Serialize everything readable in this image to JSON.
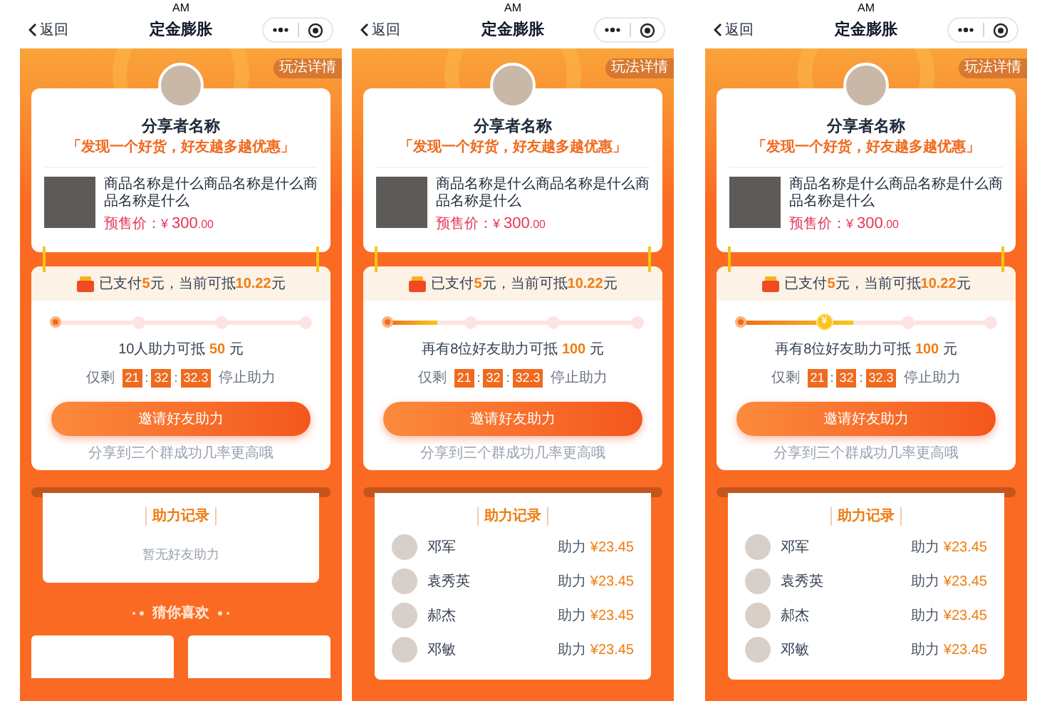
{
  "screens": [
    {
      "status_time": "AM",
      "back_label": "返回",
      "title": "定金膨胀",
      "rules_label": "玩法详情",
      "sharer_name": "分享者名称",
      "slogan": "「发现一个好货，好友越多越优惠」",
      "product": {
        "name": "商品名称是什么商品名称是什么商品名称是什么",
        "price_label": "预售价：",
        "currency": "¥",
        "price": "300",
        "price_decimals": ".00"
      },
      "paid": [
        {
          "text": "已支付",
          "em": false
        },
        {
          "text": "5",
          "em": true
        },
        {
          "text": "元，当前可抵",
          "em": false
        },
        {
          "text": "10.22",
          "em": true
        },
        {
          "text": "元",
          "em": false
        }
      ],
      "progress": {
        "level": 0,
        "nodes": [
          {
            "kind": "current"
          },
          {
            "kind": "pending"
          },
          {
            "kind": "pending"
          },
          {
            "kind": "pending"
          }
        ]
      },
      "goal": {
        "before": "10人助力可抵",
        "amount": "50",
        "after": "元"
      },
      "countdown": {
        "prefix": "仅剩",
        "parts": [
          "21",
          "32",
          "32.3"
        ],
        "separator": ":",
        "suffix": "停止助力"
      },
      "invite_button": "邀请好友助力",
      "hint": "分享到三个群成功几率更高哦",
      "records": {
        "title": "助力记录",
        "empty_text": "暂无好友助力"
      },
      "recommend_title": "猜你喜欢"
    },
    {
      "status_time": "AM",
      "back_label": "返回",
      "title": "定金膨胀",
      "rules_label": "玩法详情",
      "sharer_name": "分享者名称",
      "slogan": "「发现一个好货，好友越多越优惠」",
      "product": {
        "name": "商品名称是什么商品名称是什么商品名称是什么",
        "price_label": "预售价：",
        "currency": "¥",
        "price": "300",
        "price_decimals": ".00"
      },
      "paid": [
        {
          "text": "已支付",
          "em": false
        },
        {
          "text": "5",
          "em": true
        },
        {
          "text": "元，当前可抵",
          "em": false
        },
        {
          "text": "10.22",
          "em": true
        },
        {
          "text": "元",
          "em": false
        }
      ],
      "progress": {
        "level": 0.2,
        "nodes": [
          {
            "kind": "current"
          },
          {
            "kind": "pending"
          },
          {
            "kind": "pending"
          },
          {
            "kind": "pending"
          }
        ]
      },
      "goal": {
        "before": "再有8位好友助力可抵",
        "amount": "100",
        "after": "元"
      },
      "countdown": {
        "prefix": "仅剩",
        "parts": [
          "21",
          "32",
          "32.3"
        ],
        "separator": ":",
        "suffix": "停止助力"
      },
      "invite_button": "邀请好友助力",
      "hint": "分享到三个群成功几率更高哦",
      "records": {
        "title": "助力记录",
        "rows": [
          {
            "name": "邓军",
            "label": "助力",
            "amount": "¥23.45"
          },
          {
            "name": "袁秀英",
            "label": "助力",
            "amount": "¥23.45"
          },
          {
            "name": "郝杰",
            "label": "助力",
            "amount": "¥23.45"
          },
          {
            "name": "邓敏",
            "label": "助力",
            "amount": "¥23.45"
          }
        ]
      }
    },
    {
      "status_time": "AM",
      "back_label": "返回",
      "title": "定金膨胀",
      "rules_label": "玩法详情",
      "sharer_name": "分享者名称",
      "slogan": "「发现一个好货，好友越多越优惠」",
      "product": {
        "name": "商品名称是什么商品名称是什么商品名称是什么",
        "price_label": "预售价：",
        "currency": "¥",
        "price": "300",
        "price_decimals": ".00"
      },
      "paid": [
        {
          "text": "已支付",
          "em": false
        },
        {
          "text": "5",
          "em": true
        },
        {
          "text": "元，当前可抵",
          "em": false
        },
        {
          "text": "10.22",
          "em": true
        },
        {
          "text": "元",
          "em": false
        }
      ],
      "progress": {
        "level": 0.45,
        "nodes": [
          {
            "kind": "current"
          },
          {
            "kind": "coin",
            "label": "¥"
          },
          {
            "kind": "pending"
          },
          {
            "kind": "pending"
          }
        ]
      },
      "goal": {
        "before": "再有8位好友助力可抵",
        "amount": "100",
        "after": "元"
      },
      "countdown": {
        "prefix": "仅剩",
        "parts": [
          "21",
          "32",
          "32.3"
        ],
        "separator": ":",
        "suffix": "停止助力"
      },
      "invite_button": "邀请好友助力",
      "hint": "分享到三个群成功几率更高哦",
      "records": {
        "title": "助力记录",
        "rows": [
          {
            "name": "邓军",
            "label": "助力",
            "amount": "¥23.45"
          },
          {
            "name": "袁秀英",
            "label": "助力",
            "amount": "¥23.45"
          },
          {
            "name": "郝杰",
            "label": "助力",
            "amount": "¥23.45"
          },
          {
            "name": "邓敏",
            "label": "助力",
            "amount": "¥23.45"
          }
        ]
      }
    }
  ]
}
